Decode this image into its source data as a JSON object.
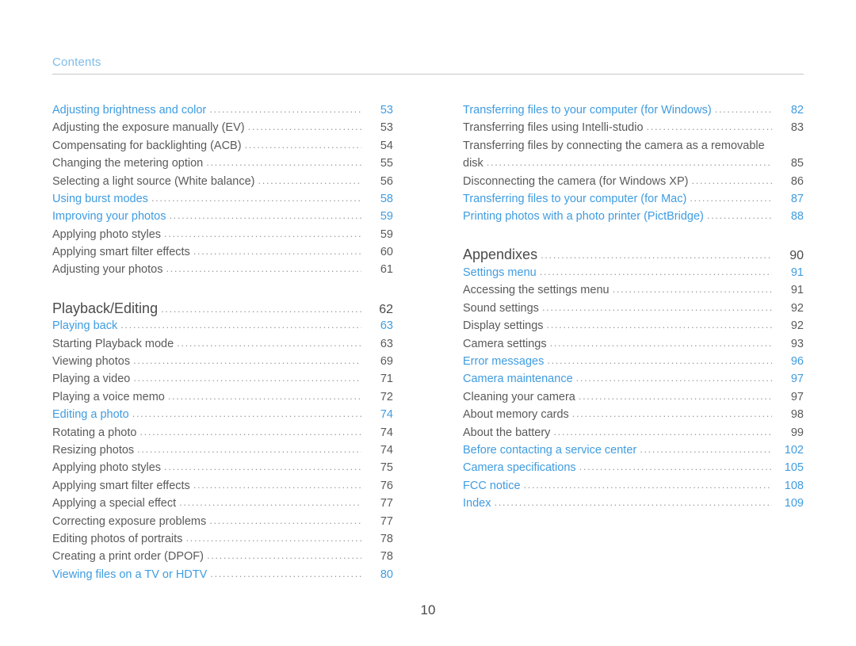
{
  "header": {
    "title": "Contents"
  },
  "page_number": "10",
  "columns": {
    "left": [
      {
        "label": "Adjusting brightness and color",
        "page": "53",
        "style": "blue"
      },
      {
        "label": "Adjusting the exposure manually (EV)",
        "page": "53",
        "style": "plain"
      },
      {
        "label": "Compensating for backlighting (ACB)",
        "page": "54",
        "style": "plain"
      },
      {
        "label": "Changing the metering option",
        "page": "55",
        "style": "plain"
      },
      {
        "label": "Selecting a light source (White balance)",
        "page": "56",
        "style": "plain"
      },
      {
        "label": "Using burst modes",
        "page": "58",
        "style": "blue"
      },
      {
        "label": "Improving your photos",
        "page": "59",
        "style": "blue"
      },
      {
        "label": "Applying photo styles",
        "page": "59",
        "style": "plain"
      },
      {
        "label": "Applying smart filter effects",
        "page": "60",
        "style": "plain"
      },
      {
        "label": "Adjusting your photos",
        "page": "61",
        "style": "plain"
      },
      {
        "label": "Playback/Editing",
        "page": "62",
        "style": "section",
        "gap": "lg"
      },
      {
        "label": "Playing back",
        "page": "63",
        "style": "blue"
      },
      {
        "label": "Starting Playback mode",
        "page": "63",
        "style": "plain"
      },
      {
        "label": "Viewing photos",
        "page": "69",
        "style": "plain"
      },
      {
        "label": "Playing a video",
        "page": "71",
        "style": "plain"
      },
      {
        "label": "Playing a voice memo",
        "page": "72",
        "style": "plain"
      },
      {
        "label": "Editing a photo",
        "page": "74",
        "style": "blue"
      },
      {
        "label": "Rotating a photo",
        "page": "74",
        "style": "plain"
      },
      {
        "label": "Resizing photos",
        "page": "74",
        "style": "plain"
      },
      {
        "label": "Applying photo styles",
        "page": "75",
        "style": "plain"
      },
      {
        "label": "Applying smart filter effects",
        "page": "76",
        "style": "plain"
      },
      {
        "label": "Applying a special effect",
        "page": "77",
        "style": "plain"
      },
      {
        "label": "Correcting exposure problems",
        "page": "77",
        "style": "plain"
      },
      {
        "label": "Editing photos of portraits",
        "page": "78",
        "style": "plain"
      },
      {
        "label": "Creating a print order (DPOF)",
        "page": "78",
        "style": "plain"
      },
      {
        "label": "Viewing files on a TV or HDTV",
        "page": "80",
        "style": "blue"
      }
    ],
    "right": [
      {
        "label": "Transferring files to your computer (for Windows)",
        "page": "82",
        "style": "blue"
      },
      {
        "label": "Transferring files using Intelli-studio",
        "page": "83",
        "style": "plain"
      },
      {
        "label": "Transferring files by connecting the camera as a removable",
        "page": "",
        "style": "wrap"
      },
      {
        "label": "disk",
        "page": "85",
        "style": "plain"
      },
      {
        "label": "Disconnecting the camera (for Windows XP)",
        "page": "86",
        "style": "plain"
      },
      {
        "label": "Transferring files to your computer (for Mac)",
        "page": "87",
        "style": "blue"
      },
      {
        "label": "Printing photos with a photo printer (PictBridge)",
        "page": "88",
        "style": "blue"
      },
      {
        "label": "Appendixes",
        "page": "90",
        "style": "section",
        "gap": "lg"
      },
      {
        "label": "Settings menu",
        "page": "91",
        "style": "blue"
      },
      {
        "label": "Accessing the settings menu",
        "page": "91",
        "style": "plain"
      },
      {
        "label": "Sound settings",
        "page": "92",
        "style": "plain"
      },
      {
        "label": "Display settings",
        "page": "92",
        "style": "plain"
      },
      {
        "label": "Camera settings",
        "page": "93",
        "style": "plain"
      },
      {
        "label": "Error messages",
        "page": "96",
        "style": "blue"
      },
      {
        "label": "Camera maintenance",
        "page": "97",
        "style": "blue"
      },
      {
        "label": "Cleaning your camera",
        "page": "97",
        "style": "plain"
      },
      {
        "label": "About memory cards",
        "page": "98",
        "style": "plain"
      },
      {
        "label": "About the battery",
        "page": "99",
        "style": "plain"
      },
      {
        "label": "Before contacting a service center",
        "page": "102",
        "style": "blue"
      },
      {
        "label": "Camera specifications",
        "page": "105",
        "style": "blue"
      },
      {
        "label": "FCC notice",
        "page": "108",
        "style": "blue"
      },
      {
        "label": "Index",
        "page": "109",
        "style": "blue"
      }
    ]
  }
}
